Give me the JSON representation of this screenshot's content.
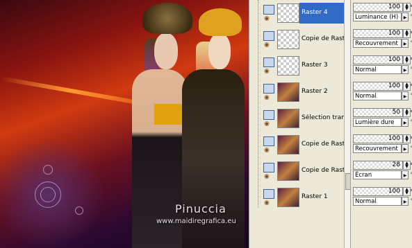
{
  "watermark": {
    "name": "Pinuccia",
    "url": "www.maidiregrafica.eu"
  },
  "layers": [
    {
      "name": "Raster 4",
      "selected": true,
      "thumb": "checker"
    },
    {
      "name": "Copie de Raste",
      "selected": false,
      "thumb": "checker"
    },
    {
      "name": "Raster 3",
      "selected": false,
      "thumb": "checker"
    },
    {
      "name": "Raster 2",
      "selected": false,
      "thumb": "people"
    },
    {
      "name": "Sélection trans",
      "selected": false,
      "thumb": "image"
    },
    {
      "name": "Copie de Raste",
      "selected": false,
      "thumb": "image"
    },
    {
      "name": "Copie de Raste",
      "selected": false,
      "thumb": "image"
    },
    {
      "name": "Raster 1",
      "selected": false,
      "thumb": "image"
    }
  ],
  "properties": [
    {
      "opacity": "100",
      "blend": "Luminance (H)"
    },
    {
      "opacity": "100",
      "blend": "Recouvrement"
    },
    {
      "opacity": "100",
      "blend": "Normal"
    },
    {
      "opacity": "100",
      "blend": "Normal"
    },
    {
      "opacity": "50",
      "blend": "Lumière dure"
    },
    {
      "opacity": "100",
      "blend": "Recouvrement"
    },
    {
      "opacity": "28",
      "blend": "Écran"
    },
    {
      "opacity": "100",
      "blend": "Normal"
    }
  ],
  "icons": {
    "visibility": "eye-icon",
    "layer": "raster-layer-icon",
    "link": "link-icon",
    "dropdown": "dropdown-arrow-icon"
  },
  "colors": {
    "selection": "#316ac5",
    "panel_bg": "#ece9d8"
  }
}
